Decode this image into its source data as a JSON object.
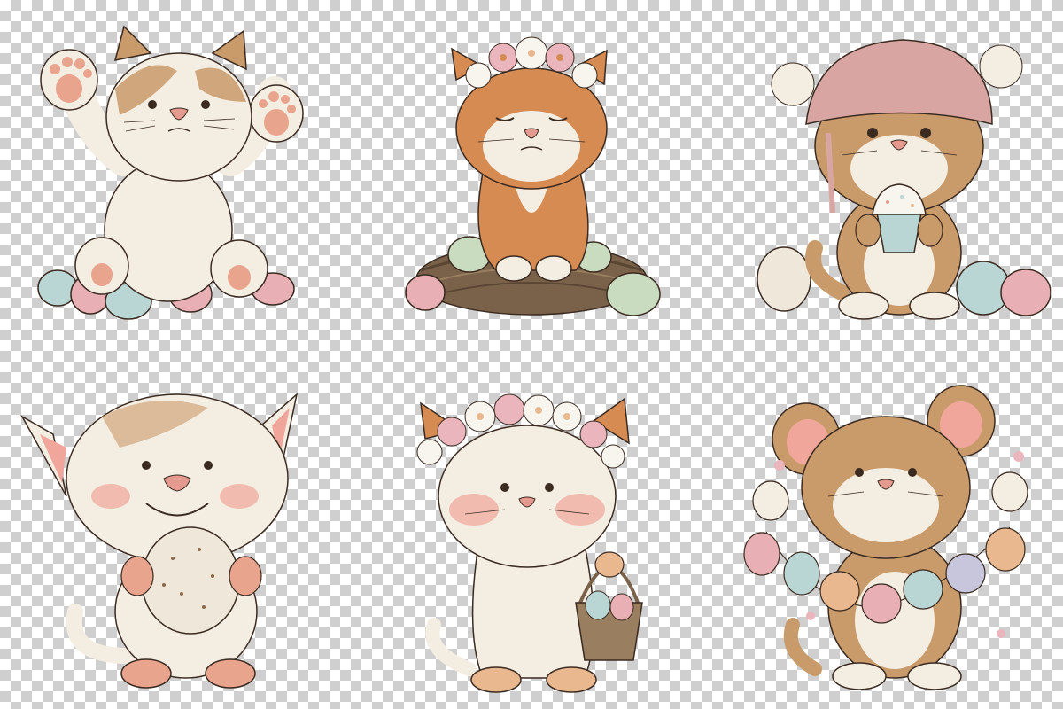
{
  "colors": {
    "checker_light": "#ffffff",
    "checker_dark": "#cfcfcf",
    "fur_white": "#f4ede2",
    "fur_tan": "#c99a6a",
    "fur_ginger": "#d58b52",
    "fur_brown": "#8a6848",
    "ink": "#3a2a20",
    "nose_pink": "#e59a90",
    "cheek_pink": "#f0a69a",
    "paw_pink": "#e9a48e",
    "egg_pink": "#e8b0b4",
    "egg_blue": "#b9d6d4",
    "egg_mint": "#c9dcc0",
    "egg_peach": "#e9b88f",
    "egg_lavender": "#c8c6dc",
    "egg_cream": "#efe7da",
    "nest_brown": "#7a624a",
    "hat_pink": "#d9a5a2",
    "flower_pink": "#eab5bd",
    "flower_white": "#f8f4ee"
  },
  "illustrations": [
    {
      "name": "kitten-paws-up"
    },
    {
      "name": "ginger-kitten-flower-crown-in-nest"
    },
    {
      "name": "kitten-pink-hat-cupcake"
    },
    {
      "name": "smiling-kitten-holding-egg"
    },
    {
      "name": "kitten-flower-crown-egg-basket"
    },
    {
      "name": "kitten-egg-garland"
    }
  ]
}
